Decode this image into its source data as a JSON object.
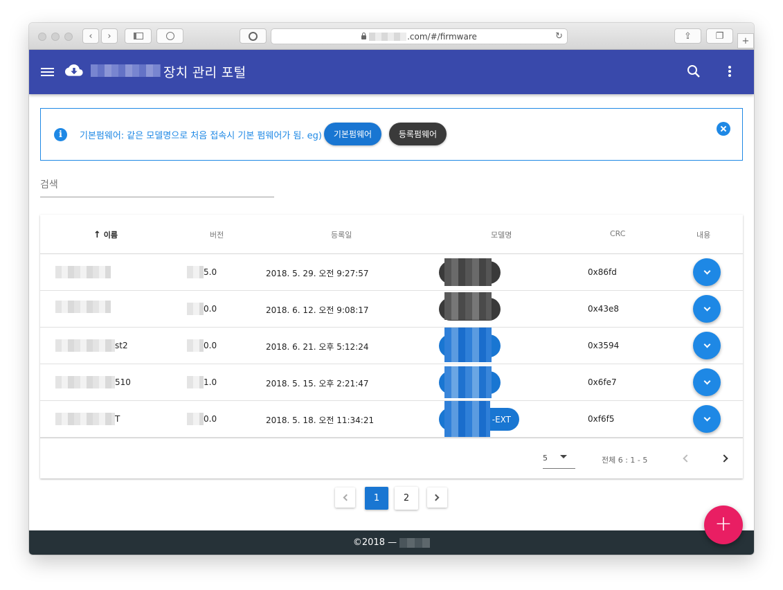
{
  "browser": {
    "url_suffix": ".com/#/firmware"
  },
  "appbar": {
    "title": "장치 관리 포털",
    "icons": [
      "menu-icon",
      "cloud-download-icon",
      "search-icon",
      "more-vert-icon"
    ]
  },
  "alert": {
    "text": "기본펌웨어: 같은 모델명으로 처음 접속시 기본 펌웨어가 됨. eg)",
    "button_default": "기본펌웨어",
    "button_registered": "등록펌웨어"
  },
  "search": {
    "placeholder": "검색"
  },
  "table": {
    "headers": {
      "name": "이름",
      "version": "버전",
      "date": "등록일",
      "model": "모델명",
      "crc": "CRC",
      "content": "내용"
    },
    "rows": [
      {
        "name": "",
        "version": "5.0",
        "date": "2018. 5. 29. 오전 9:27:57",
        "model": "",
        "crc": "0x86fd"
      },
      {
        "name": "",
        "version": "0.0",
        "date": "2018. 6. 12. 오전 9:08:17",
        "model": "",
        "crc": "0x43e8"
      },
      {
        "name": "st2",
        "version": "0.0",
        "date": "2018. 6. 21. 오후 5:12:24",
        "model": "",
        "crc": "0x3594"
      },
      {
        "name": "510",
        "version": "1.0",
        "date": "2018. 5. 15. 오후 2:21:47",
        "model": "",
        "crc": "0x6fe7"
      },
      {
        "name": "T",
        "version": "0.0",
        "date": "2018. 5. 18. 오전 11:34:21",
        "model": "-EXT",
        "crc": "0xf6f5"
      }
    ],
    "rows_per_page": "5",
    "range_text": "전체 6 : 1 - 5"
  },
  "pagination": {
    "pages": [
      "1",
      "2"
    ],
    "current": "1"
  },
  "fab_label": "+",
  "footer": {
    "text": "©2018 —"
  },
  "colors": {
    "primary": "#3949ab",
    "accent_blue": "#1e88e5",
    "dark_chip": "#3a3a3a",
    "fab": "#e91e63",
    "footer": "#263238"
  }
}
